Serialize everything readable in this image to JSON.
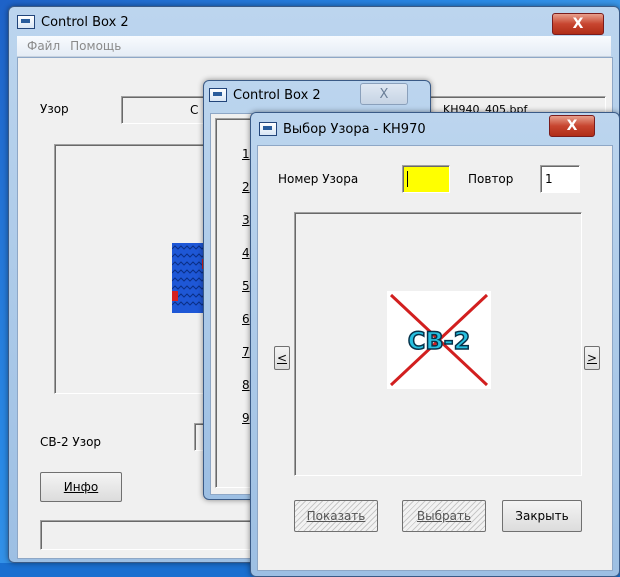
{
  "main_window": {
    "title": "Control Box 2",
    "close_glyph": "X",
    "menu": [
      "Файл",
      "Помощь"
    ],
    "pattern_label": "Узор",
    "pattern_field_fragment": "С",
    "cb2_pattern_label": "CB-2 Узор",
    "info_button": "Инфо",
    "file_name_fragment": "KH940_405.bpf"
  },
  "middle_window": {
    "title": "Control Box 2",
    "close_glyph": "X",
    "numbers": [
      "1",
      "2",
      "3",
      "4",
      "5",
      "6",
      "7",
      "8",
      "9"
    ]
  },
  "dialog": {
    "title": "Выбор Узора - KH970",
    "close_glyph": "X",
    "pattern_number_label": "Номер Узора",
    "pattern_number_value": "",
    "repeat_label": "Повтор",
    "repeat_value": "1",
    "prev_button": "<",
    "next_button": ">",
    "logo_text": "CB-2",
    "show_button": "Показать",
    "select_button": "Выбрать",
    "close_button": "Закрыть"
  },
  "colors": {
    "pattern_number_bg": "#ffff00",
    "knit_blue": "#1e57d6",
    "knit_red": "#d42020",
    "logo_cross": "#d21f1f",
    "logo_fill": "#27c0e0"
  }
}
